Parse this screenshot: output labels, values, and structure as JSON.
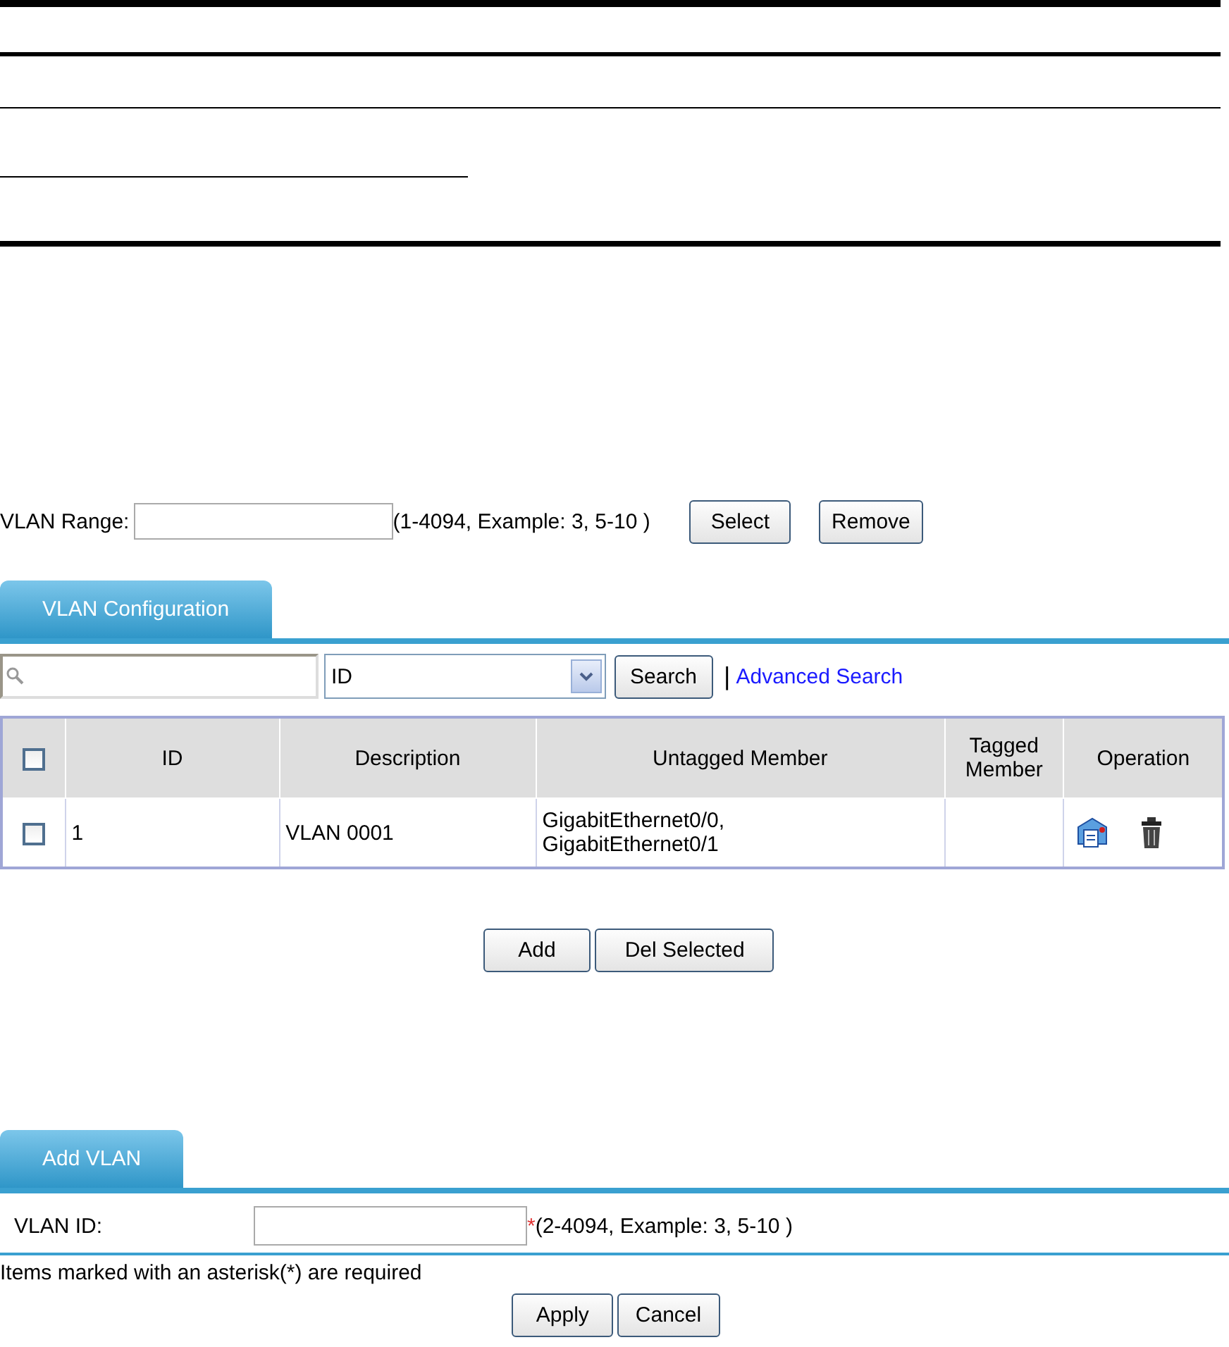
{
  "range": {
    "label": "VLAN Range:",
    "hint": "(1-4094, Example: 3, 5-10 )",
    "buttons": [
      "Select",
      "Remove"
    ]
  },
  "config_tab": {
    "label": "VLAN Configuration",
    "selected": true
  },
  "search": {
    "select_value": "ID",
    "button": "Search",
    "separator": "|",
    "link": "Advanced Search"
  },
  "table": {
    "select_all_checked": false,
    "columns": [
      "ID",
      "Description",
      "Untagged Member",
      "Tagged Member",
      "Operation"
    ],
    "rows": [
      {
        "checked": false,
        "id": "1",
        "description": "VLAN 0001",
        "untagged": [
          "GigabitEthernet0/0,",
          "GigabitEthernet0/1"
        ]
      }
    ]
  },
  "table_buttons": [
    "Add",
    "Del Selected"
  ],
  "add_tab": {
    "label": "Add VLAN",
    "selected": true
  },
  "form": {
    "label": "VLAN ID:",
    "required": true,
    "required_mark": "*",
    "hint": "(2-4094, Example: 3, 5-10 )"
  },
  "note": "Items marked with an asterisk(*) are required",
  "form_buttons": [
    "Apply",
    "Cancel"
  ]
}
